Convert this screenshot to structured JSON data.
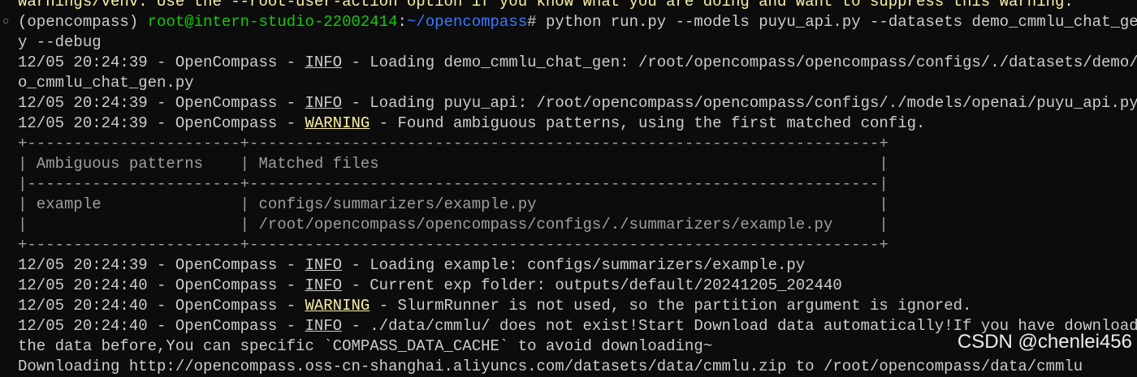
{
  "terminal": {
    "lines": [
      {
        "kind": "plain",
        "class": "yellow",
        "text": "warnings/venv. Use the --root-user-action option if you know what you are doing and want to suppress this warning."
      },
      {
        "kind": "prompt",
        "marker": "○",
        "env": "(opencompass) ",
        "userhost": "root@intern-studio-22002414",
        "colon": ":",
        "path": "~/opencompass",
        "symbol": "# ",
        "command": "python run.py --models puyu_api.py --datasets demo_cmmlu_chat_gen.p"
      },
      {
        "kind": "plain",
        "class": "",
        "text": "y --debug"
      },
      {
        "kind": "log",
        "prefix": "12/05 20:24:39 - OpenCompass - ",
        "level": "INFO",
        "message": " - Loading demo_cmmlu_chat_gen: /root/opencompass/opencompass/configs/./datasets/demo/dem"
      },
      {
        "kind": "plain",
        "class": "",
        "text": "o_cmmlu_chat_gen.py"
      },
      {
        "kind": "log",
        "prefix": "12/05 20:24:39 - OpenCompass - ",
        "level": "INFO",
        "message": " - Loading puyu_api: /root/opencompass/opencompass/configs/./models/openai/puyu_api.py"
      },
      {
        "kind": "log",
        "prefix": "12/05 20:24:39 - OpenCompass - ",
        "level": "WARNING",
        "message": " - Found ambiguous patterns, using the first matched config."
      },
      {
        "kind": "table",
        "text": "+-----------------------+--------------------------------------------------------------------+"
      },
      {
        "kind": "table",
        "text": "| Ambiguous patterns    | Matched files                                                      |"
      },
      {
        "kind": "table",
        "text": "|-----------------------+--------------------------------------------------------------------|"
      },
      {
        "kind": "table",
        "text": "| example               | configs/summarizers/example.py                                     |"
      },
      {
        "kind": "table",
        "text": "|                       | /root/opencompass/opencompass/configs/./summarizers/example.py     |"
      },
      {
        "kind": "table",
        "text": "+-----------------------+--------------------------------------------------------------------+"
      },
      {
        "kind": "log",
        "prefix": "12/05 20:24:39 - OpenCompass - ",
        "level": "INFO",
        "message": " - Loading example: configs/summarizers/example.py"
      },
      {
        "kind": "log",
        "prefix": "12/05 20:24:40 - OpenCompass - ",
        "level": "INFO",
        "message": " - Current exp folder: outputs/default/20241205_202440"
      },
      {
        "kind": "log",
        "prefix": "12/05 20:24:40 - OpenCompass - ",
        "level": "WARNING",
        "message": " - SlurmRunner is not used, so the partition argument is ignored."
      },
      {
        "kind": "log",
        "prefix": "12/05 20:24:40 - OpenCompass - ",
        "level": "INFO",
        "message": " - ./data/cmmlu/ does not exist!Start Download data automatically!If you have downloaded"
      },
      {
        "kind": "plain",
        "class": "",
        "text": "the data before,You can specific `COMPASS_DATA_CACHE` to avoid downloading~"
      },
      {
        "kind": "plain",
        "class": "",
        "text": "Downloading http://opencompass.oss-cn-shanghai.aliyuncs.com/datasets/data/cmmlu.zip to /root/opencompass/data/cmmlu"
      }
    ]
  },
  "watermark": "CSDN @chenlei456",
  "colors": {
    "background": "#0c0c0c",
    "foreground": "#cccccc",
    "prompt_green": "#16c60c",
    "path_blue": "#3b78ff",
    "warning_yellow": "#f9f1a5"
  }
}
